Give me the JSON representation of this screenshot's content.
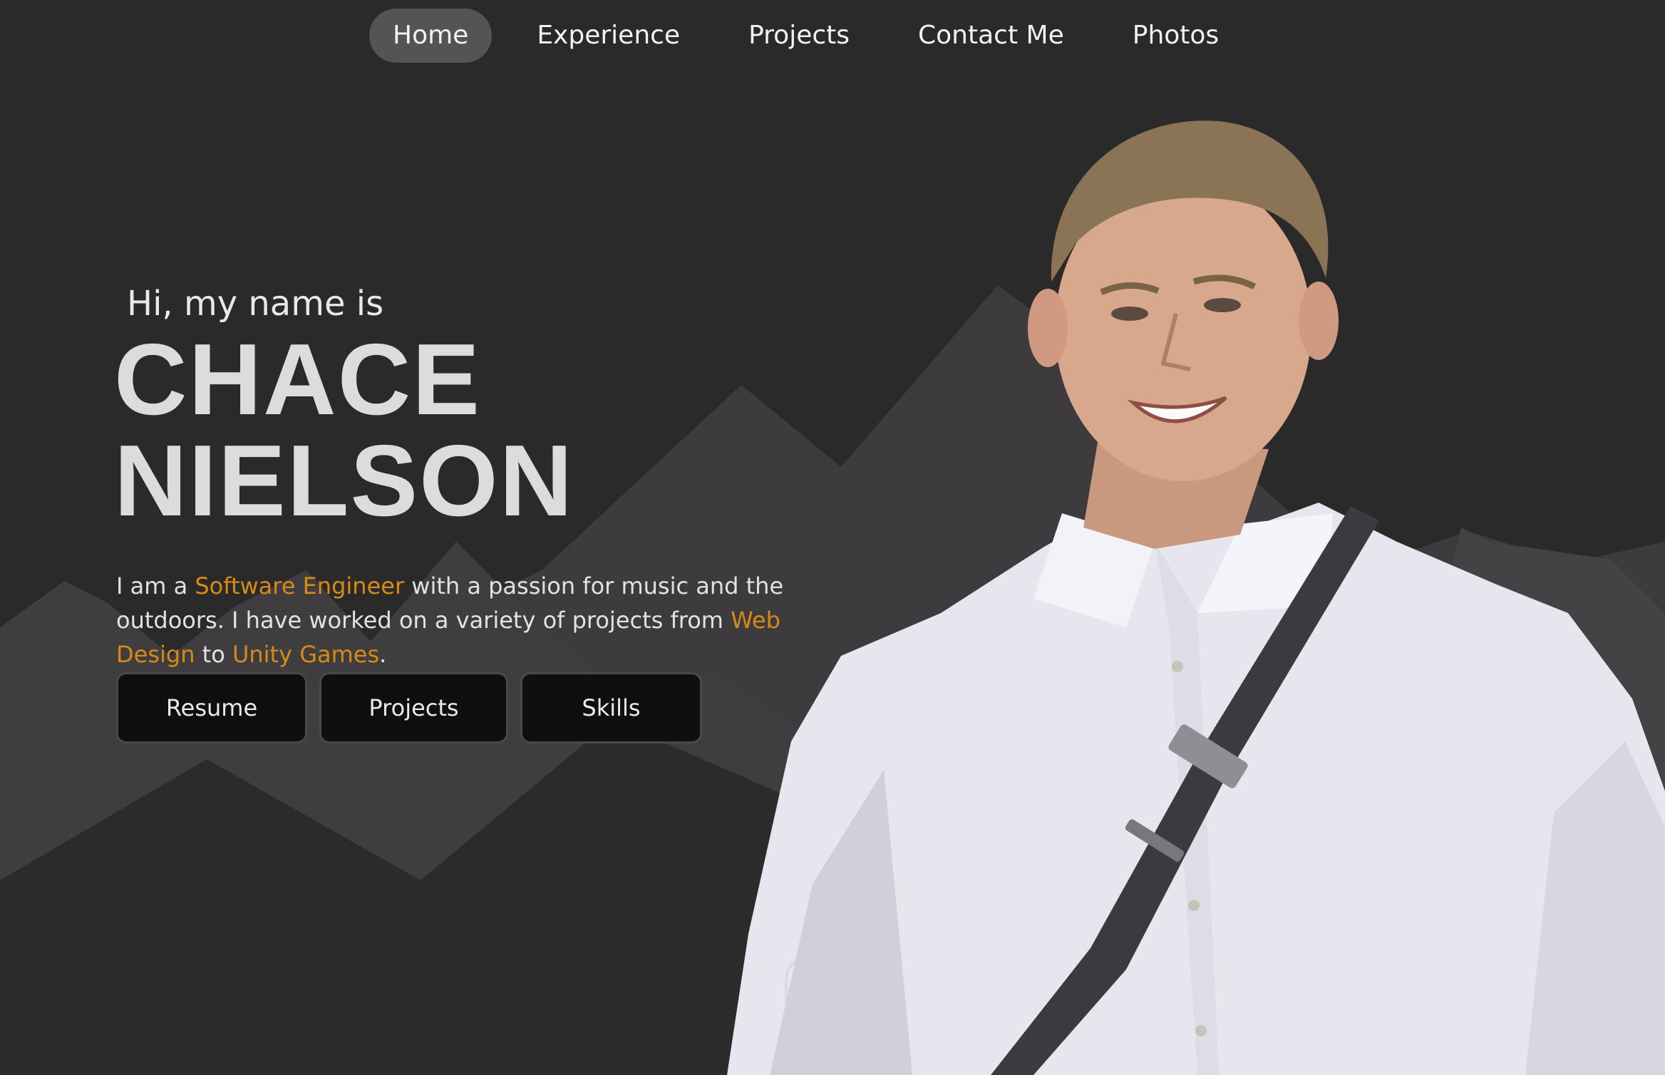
{
  "nav": {
    "items": [
      {
        "label": "Home",
        "active": true
      },
      {
        "label": "Experience",
        "active": false
      },
      {
        "label": "Projects",
        "active": false
      },
      {
        "label": "Contact Me",
        "active": false
      },
      {
        "label": "Photos",
        "active": false
      }
    ]
  },
  "hero": {
    "intro": "Hi, my name is",
    "first_name": "CHACE",
    "last_name": "NIELSON",
    "bio": {
      "part1": "I am a ",
      "highlight1": "Software Engineer",
      "part2": " with a passion for music and the outdoors. I have worked on a variety of projects from ",
      "highlight2": "Web Design",
      "part3": " to ",
      "highlight3": "Unity Games",
      "part4": "."
    },
    "buttons": {
      "resume": "Resume",
      "projects": "Projects",
      "skills": "Skills"
    }
  },
  "colors": {
    "background": "#2b2a2b",
    "accent": "#d88a17",
    "nav_active": "#555455"
  },
  "icons": {
    "scroll": "mouse-scroll-icon"
  }
}
